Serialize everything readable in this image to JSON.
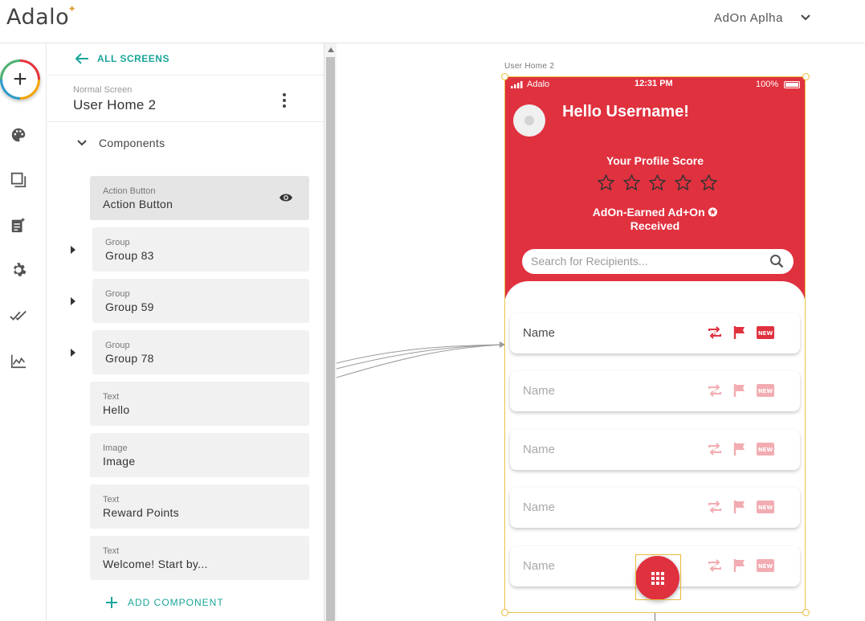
{
  "topbar": {
    "logo": "Adalo",
    "app_name": "AdOn Aplha"
  },
  "rail": {
    "icons": [
      "plus-icon",
      "palette-icon",
      "screens-icon",
      "database-icon",
      "gear-icon",
      "publish-check-icon",
      "analytics-icon"
    ]
  },
  "panel": {
    "back_label": "ALL SCREENS",
    "screen_type": "Normal Screen",
    "screen_name": "User Home 2",
    "components_label": "Components",
    "components": [
      {
        "type": "Action Button",
        "name": "Action Button"
      },
      {
        "type": "Group",
        "name": "Group 83"
      },
      {
        "type": "Group",
        "name": "Group 59"
      },
      {
        "type": "Group",
        "name": "Group 78"
      },
      {
        "type": "Text",
        "name": "Hello"
      },
      {
        "type": "Image",
        "name": "Image"
      },
      {
        "type": "Text",
        "name": "Reward Points"
      },
      {
        "type": "Text",
        "name": "Welcome! Start by..."
      }
    ],
    "add_component_label": "ADD COMPONENT"
  },
  "canvas": {
    "screen_label": "User Home 2",
    "status": {
      "carrier": "Adalo",
      "time": "12:31 PM",
      "battery": "100%"
    },
    "greeting": "Hello Username!",
    "score_title": "Your Profile Score",
    "star_count": 5,
    "earned_label": "AdOn-Earned Ad+On ✪ Received",
    "search_placeholder": "Search for Recipients...",
    "rows": [
      "Name",
      "Name",
      "Name",
      "Name",
      "Name"
    ],
    "badge_text": "NEW",
    "accent": "#e0313f",
    "teal": "#1aa59a"
  }
}
